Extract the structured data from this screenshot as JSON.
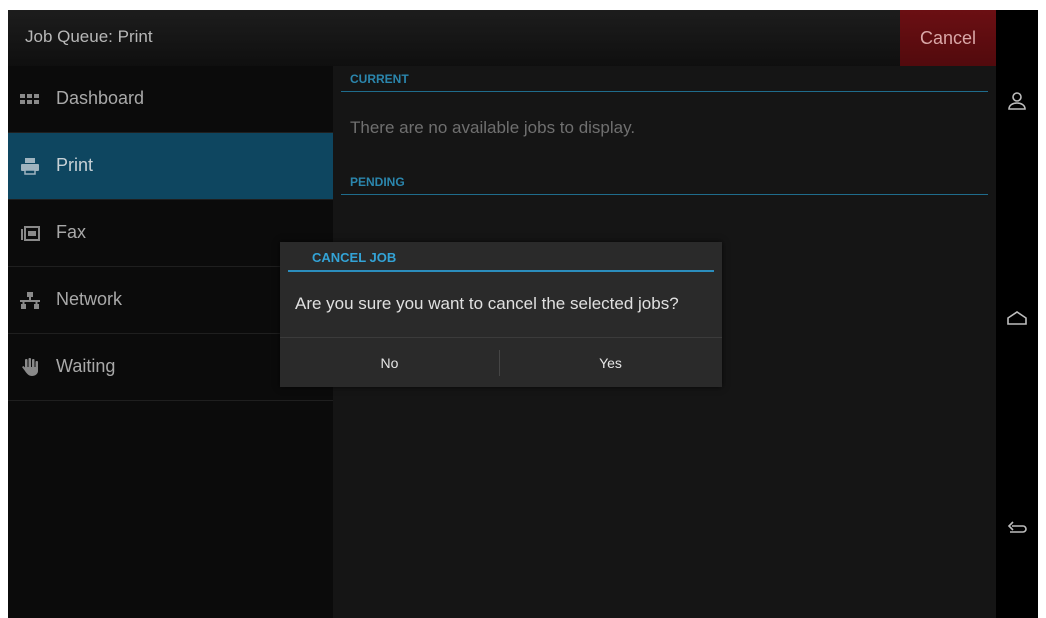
{
  "header": {
    "title": "Job Queue: Print",
    "cancel_label": "Cancel"
  },
  "sidebar": {
    "items": [
      {
        "label": "Dashboard",
        "icon": "dashboard-icon"
      },
      {
        "label": "Print",
        "icon": "printer-icon",
        "active": true
      },
      {
        "label": "Fax",
        "icon": "fax-icon"
      },
      {
        "label": "Network",
        "icon": "network-icon"
      },
      {
        "label": "Waiting",
        "icon": "hand-icon"
      }
    ]
  },
  "main": {
    "current_header": "CURRENT",
    "empty_message": "There are no available jobs to display.",
    "pending_header": "PENDING"
  },
  "dialog": {
    "title": "CANCEL JOB",
    "message": "Are you sure you want to cancel the selected jobs?",
    "no_label": "No",
    "yes_label": "Yes"
  },
  "navbar": {
    "icons": [
      "user-icon",
      "home-icon",
      "back-icon"
    ]
  },
  "colors": {
    "accent": "#2b86ad",
    "active_item": "#0e4660",
    "cancel_bg": "#6b0f13"
  }
}
